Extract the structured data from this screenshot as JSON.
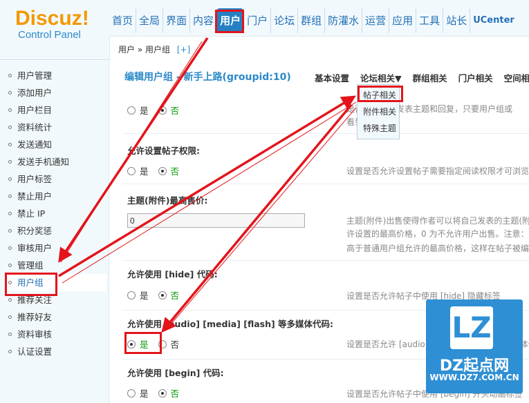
{
  "logo": {
    "title": "Discuz!",
    "subtitle": "Control Panel"
  },
  "topnav": [
    {
      "label": "首页"
    },
    {
      "label": "全局"
    },
    {
      "label": "界面"
    },
    {
      "label": "内容"
    },
    {
      "label": "用户",
      "active": true
    },
    {
      "label": "门户"
    },
    {
      "label": "论坛"
    },
    {
      "label": "群组"
    },
    {
      "label": "防灌水"
    },
    {
      "label": "运营"
    },
    {
      "label": "应用"
    },
    {
      "label": "工具"
    },
    {
      "label": "站长"
    },
    {
      "label": "UCenter"
    }
  ],
  "breadcrumb": {
    "text": "用户 » 用户组",
    "plus": "[+]"
  },
  "sidebar": {
    "items": [
      {
        "label": "用户管理"
      },
      {
        "label": "添加用户"
      },
      {
        "label": "用户栏目"
      },
      {
        "label": "资料统计"
      },
      {
        "label": "发送通知"
      },
      {
        "label": "发送手机通知"
      },
      {
        "label": "用户标签"
      },
      {
        "label": "禁止用户"
      },
      {
        "label": "禁止 IP"
      },
      {
        "label": "积分奖惩"
      },
      {
        "label": "审核用户"
      },
      {
        "label": "管理组"
      },
      {
        "label": "用户组",
        "active": true
      },
      {
        "label": "推荐关注"
      },
      {
        "label": "推荐好友"
      },
      {
        "label": "资料审核"
      },
      {
        "label": "认证设置"
      }
    ]
  },
  "main": {
    "title": "编辑用户组 - 新手上路(groupid:10)",
    "tabs": [
      {
        "label": "基本设置"
      },
      {
        "label": "论坛相关▼"
      },
      {
        "label": "群组相关"
      },
      {
        "label": "门户相关"
      },
      {
        "label": "空间相"
      }
    ],
    "dropdown": [
      {
        "label": "帖子相关"
      },
      {
        "label": "附件相关"
      },
      {
        "label": "特殊主题"
      }
    ],
    "yes": "是",
    "no": "否",
    "desc1a": "是否允许匿名发表主题和回复，只要用户组或",
    "desc1b": "看到",
    "s2_label": "允许设置帖子权限:",
    "s2_desc": "设置是否允许设置帖子需要指定阅读权限才可浏览",
    "s3_label": "主题(附件)最高售价:",
    "s3_value": "0",
    "s3_desc1": "主题(附件)出售使得作者可以将自己发表的主题(附",
    "s3_desc2": "许设置的最高价格，0 为不允许用户出售。注意：",
    "s3_desc3": "高于普通用户组允许的最高价格，这样在帖子被编",
    "s4_label": "允许使用 [hide] 代码:",
    "s4_desc": "设置是否允许帖子中使用 [hide] 隐藏标签",
    "s5_label": "允许使用 [audio] [media] [flash] 等多媒体代码:",
    "s5_desc": "设置是否允许 [audio] [media] [flash] 等多媒体代",
    "s6_label": "允许使用 [begin] 代码:",
    "s6_desc": "设置是否允许帖子中使用 [begin] 开头动画标签"
  },
  "watermark": {
    "logo": "LZ",
    "name": "DZ起点网",
    "url": "WWW.DZ7.COM.CN"
  },
  "colors": {
    "accent": "#2b8ac9",
    "highlight": "#e3141b",
    "logo": "#f39800",
    "yes_green": "#0a9b0a"
  }
}
